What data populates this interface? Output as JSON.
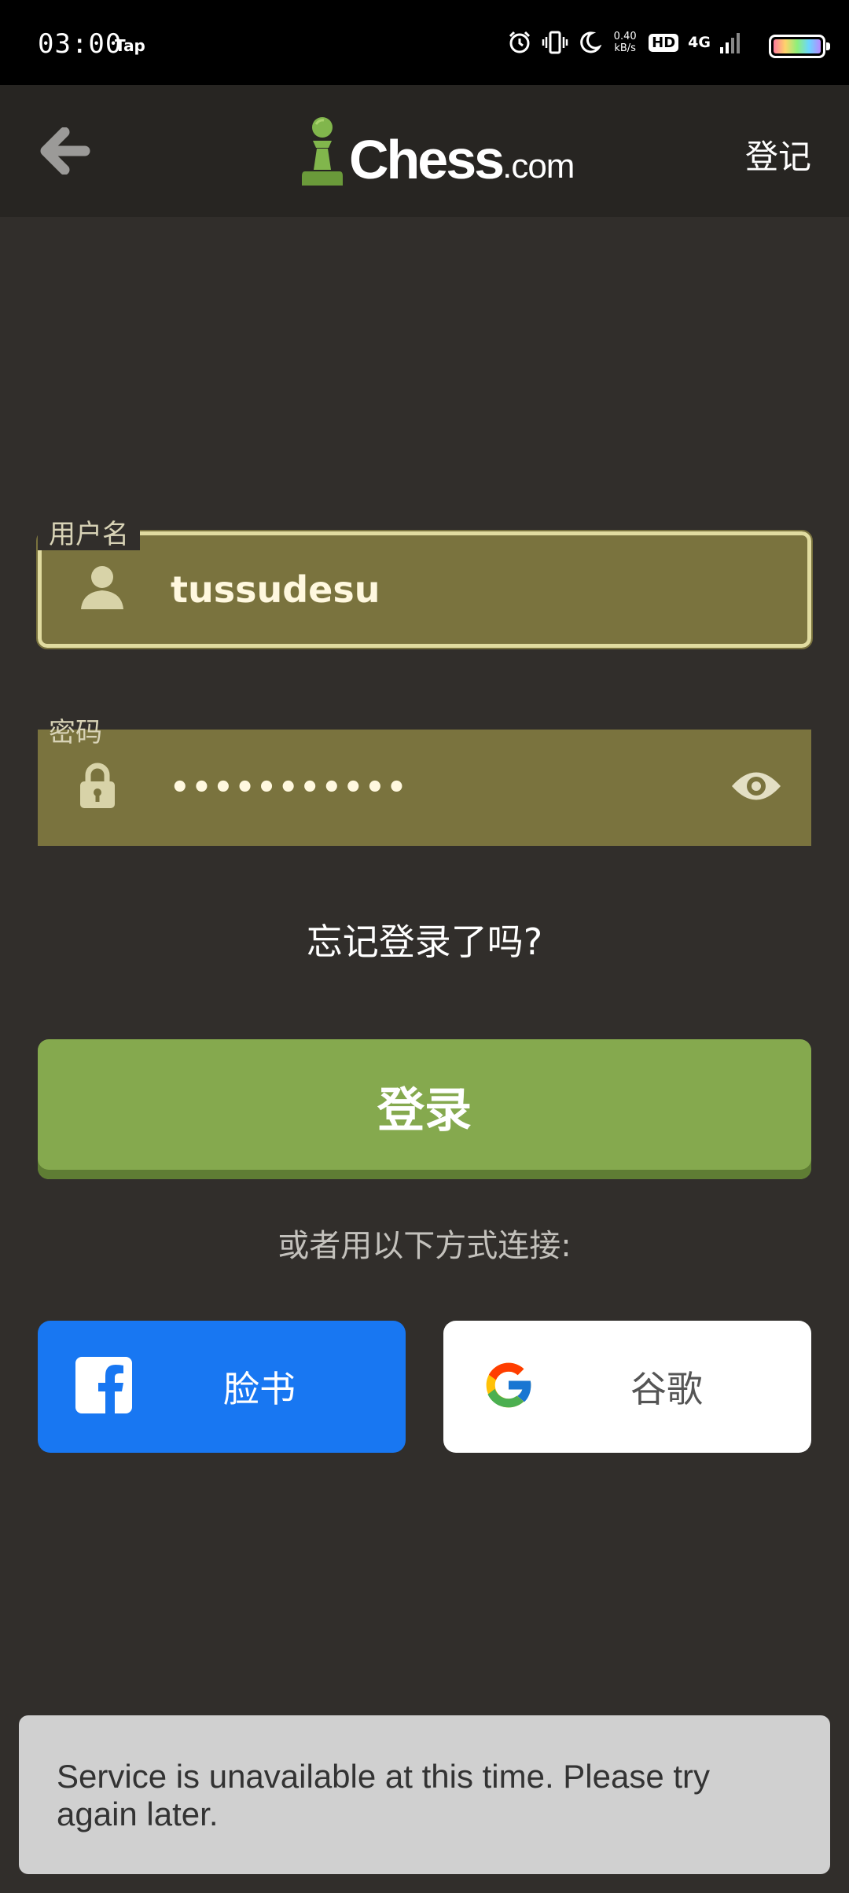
{
  "status_bar": {
    "time": "03:00",
    "app_name": "Tap",
    "net_speed_value": "0.40",
    "net_speed_unit": "kB/s",
    "hd_label": "HD",
    "network_label": "4G"
  },
  "header": {
    "logo_word": "Chess",
    "logo_suffix": ".com",
    "register_label": "登记"
  },
  "form": {
    "username": {
      "label": "用户名",
      "value": "tussudesu"
    },
    "password": {
      "label": "密码",
      "masked_value": "•••••••••••"
    },
    "forgot_label": "忘记登录了吗?",
    "login_label": "登录"
  },
  "social": {
    "connect_label": "或者用以下方式连接:",
    "facebook_label": "脸书",
    "google_label": "谷歌"
  },
  "toast": {
    "message": "Service is unavailable at this time. Please try again later."
  },
  "colors": {
    "background": "#312e2b",
    "header": "#272522",
    "field": "#7a733e",
    "field_focus_border": "#e1dca0",
    "login_green": "#85a94e",
    "facebook_blue": "#1877f2",
    "toast": "#d0d0d0"
  }
}
